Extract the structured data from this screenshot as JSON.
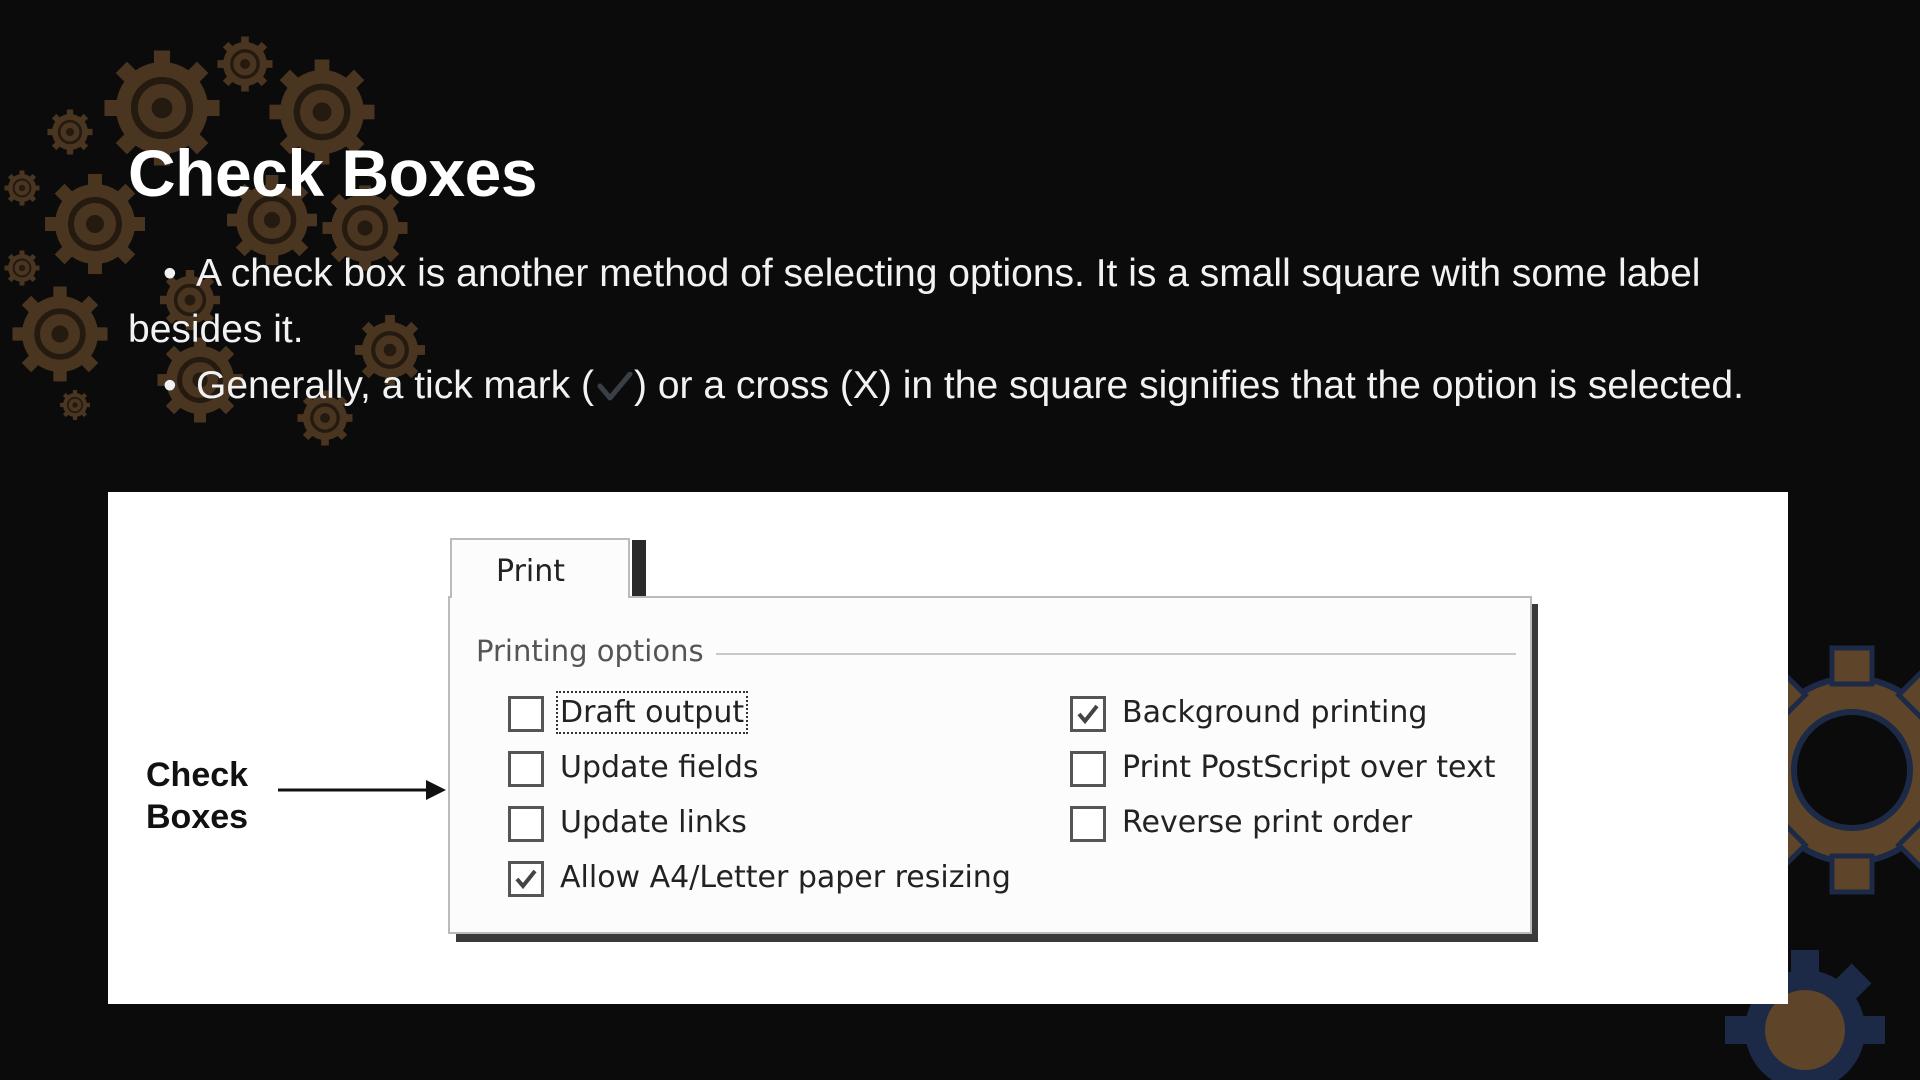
{
  "slide": {
    "title": "Check Boxes",
    "bullets": [
      "A check box is another method of selecting options. It is a small square with some label besides it.",
      {
        "before": "Generally, a tick mark (",
        "after": ") or a cross (X) in the square signifies that the option is selected."
      }
    ]
  },
  "figure": {
    "callout_line1": "Check",
    "callout_line2": "Boxes",
    "tab_label": "Print",
    "group_label": "Printing options",
    "left_options": [
      {
        "label": "Draft output",
        "checked": false
      },
      {
        "label": "Update fields",
        "checked": false
      },
      {
        "label": "Update links",
        "checked": false
      },
      {
        "label": "Allow A4/Letter paper resizing",
        "checked": true
      }
    ],
    "right_options": [
      {
        "label": "Background printing",
        "checked": true
      },
      {
        "label": "Print PostScript over text",
        "checked": false
      },
      {
        "label": "Reverse print order",
        "checked": false
      }
    ]
  },
  "colors": {
    "background": "#0b0b0b",
    "gear_brown": "#5e4428",
    "gear_navy": "#1c2a48",
    "text": "#ffffff"
  }
}
